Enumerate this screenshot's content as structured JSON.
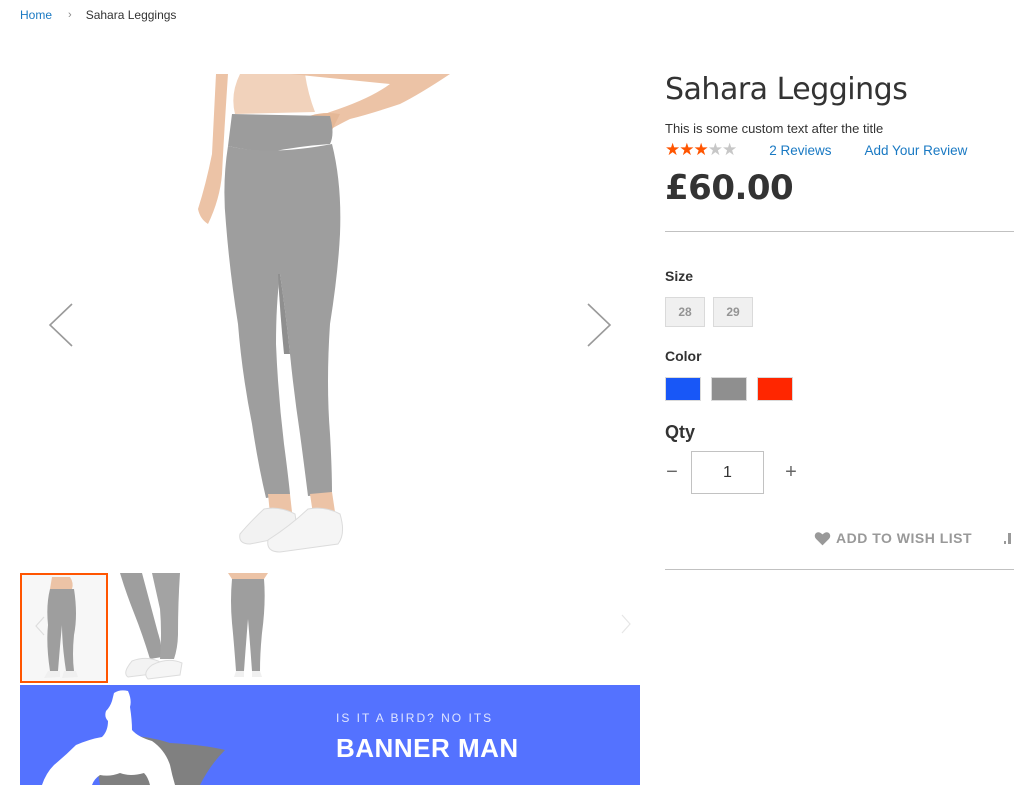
{
  "breadcrumb": {
    "home": "Home",
    "separator": "›",
    "current": "Sahara Leggings"
  },
  "product": {
    "title": "Sahara Leggings",
    "custom_text": "This is some custom text after the title",
    "rating": {
      "value": 3,
      "max": 5
    },
    "reviews_link": "2 Reviews",
    "add_review_link": "Add Your Review",
    "price": "£60.00"
  },
  "gallery": {
    "main_image": "leggings-front-view",
    "prev_icon": "chevron-left-icon",
    "next_icon": "chevron-right-icon",
    "thumbnails": [
      {
        "name": "leggings-front",
        "active": true
      },
      {
        "name": "leggings-detail-shoes",
        "active": false
      },
      {
        "name": "leggings-back",
        "active": false
      }
    ]
  },
  "banner": {
    "pretitle": "IS IT A BIRD? NO ITS",
    "title": "BANNER MAN",
    "background": "#5472ff"
  },
  "options": {
    "size_label": "Size",
    "sizes": [
      "28",
      "29"
    ],
    "color_label": "Color",
    "colors": [
      {
        "name": "Blue",
        "hex": "#1857f7"
      },
      {
        "name": "Gray",
        "hex": "#8f8f8f"
      },
      {
        "name": "Red",
        "hex": "#ff2600"
      }
    ]
  },
  "qty": {
    "label": "Qty",
    "value": "1",
    "minus": "−",
    "plus": "+"
  },
  "actions": {
    "wishlist": "ADD TO WISH LIST",
    "compare_icon": "compare-icon"
  },
  "colors": {
    "accent": "#ff5501",
    "link": "#1979c3",
    "star_empty": "#c7c7c7"
  }
}
